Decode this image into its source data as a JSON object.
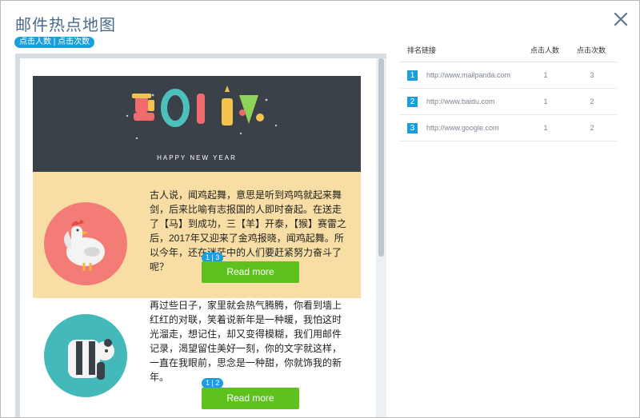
{
  "window": {
    "title": "邮件热点地图"
  },
  "legend": {
    "label": "点击人数 | 点击次数"
  },
  "email": {
    "banner": {
      "year": "2017",
      "greeting": "HAPPY NEW YEAR"
    },
    "sections": [
      {
        "text": "古人说，闻鸡起舞，意思是听到鸡鸣就起来舞剑，后来比喻有志报国的人即时奋起。在送走了【马】到成功，三【羊】开泰，【猴】赛雷之后，2017年又迎来了金鸡报晓，闻鸡起舞。所以今年，还在迷茫中的人们要赶紧努力奋斗了呢？",
        "button": "Read more",
        "badge": "1 | 3",
        "illustration": "rooster"
      },
      {
        "text": "再过些日子，家里就会热气腾腾，你看到墙上红红的对联，笑着说新年是一种暖，我怕这时光溜走，想记住，却又变得模糊，我们用邮件记录，渴望留住美好一刻，你的文字就这样，一直在我眼前，思念是一种甜，你就饰我的新年。",
        "button": "Read more",
        "badge": "1 | 2",
        "illustration": "panda"
      }
    ]
  },
  "ranking": {
    "headers": {
      "link": "排名链接",
      "people": "点击人数",
      "clicks": "点击次数"
    },
    "rows": [
      {
        "rank": "1",
        "url": "http://www.mailpanda.com",
        "people": "1",
        "clicks": "3"
      },
      {
        "rank": "2",
        "url": "http://www.baidu.com",
        "people": "1",
        "clicks": "2"
      },
      {
        "rank": "3",
        "url": "http://www.google.com",
        "people": "1",
        "clicks": "2"
      }
    ]
  },
  "colors": {
    "accent": "#1a9edc",
    "button": "#5dc21e",
    "section1_bg": "#f8dea4",
    "banner_bg": "#3a4149"
  }
}
